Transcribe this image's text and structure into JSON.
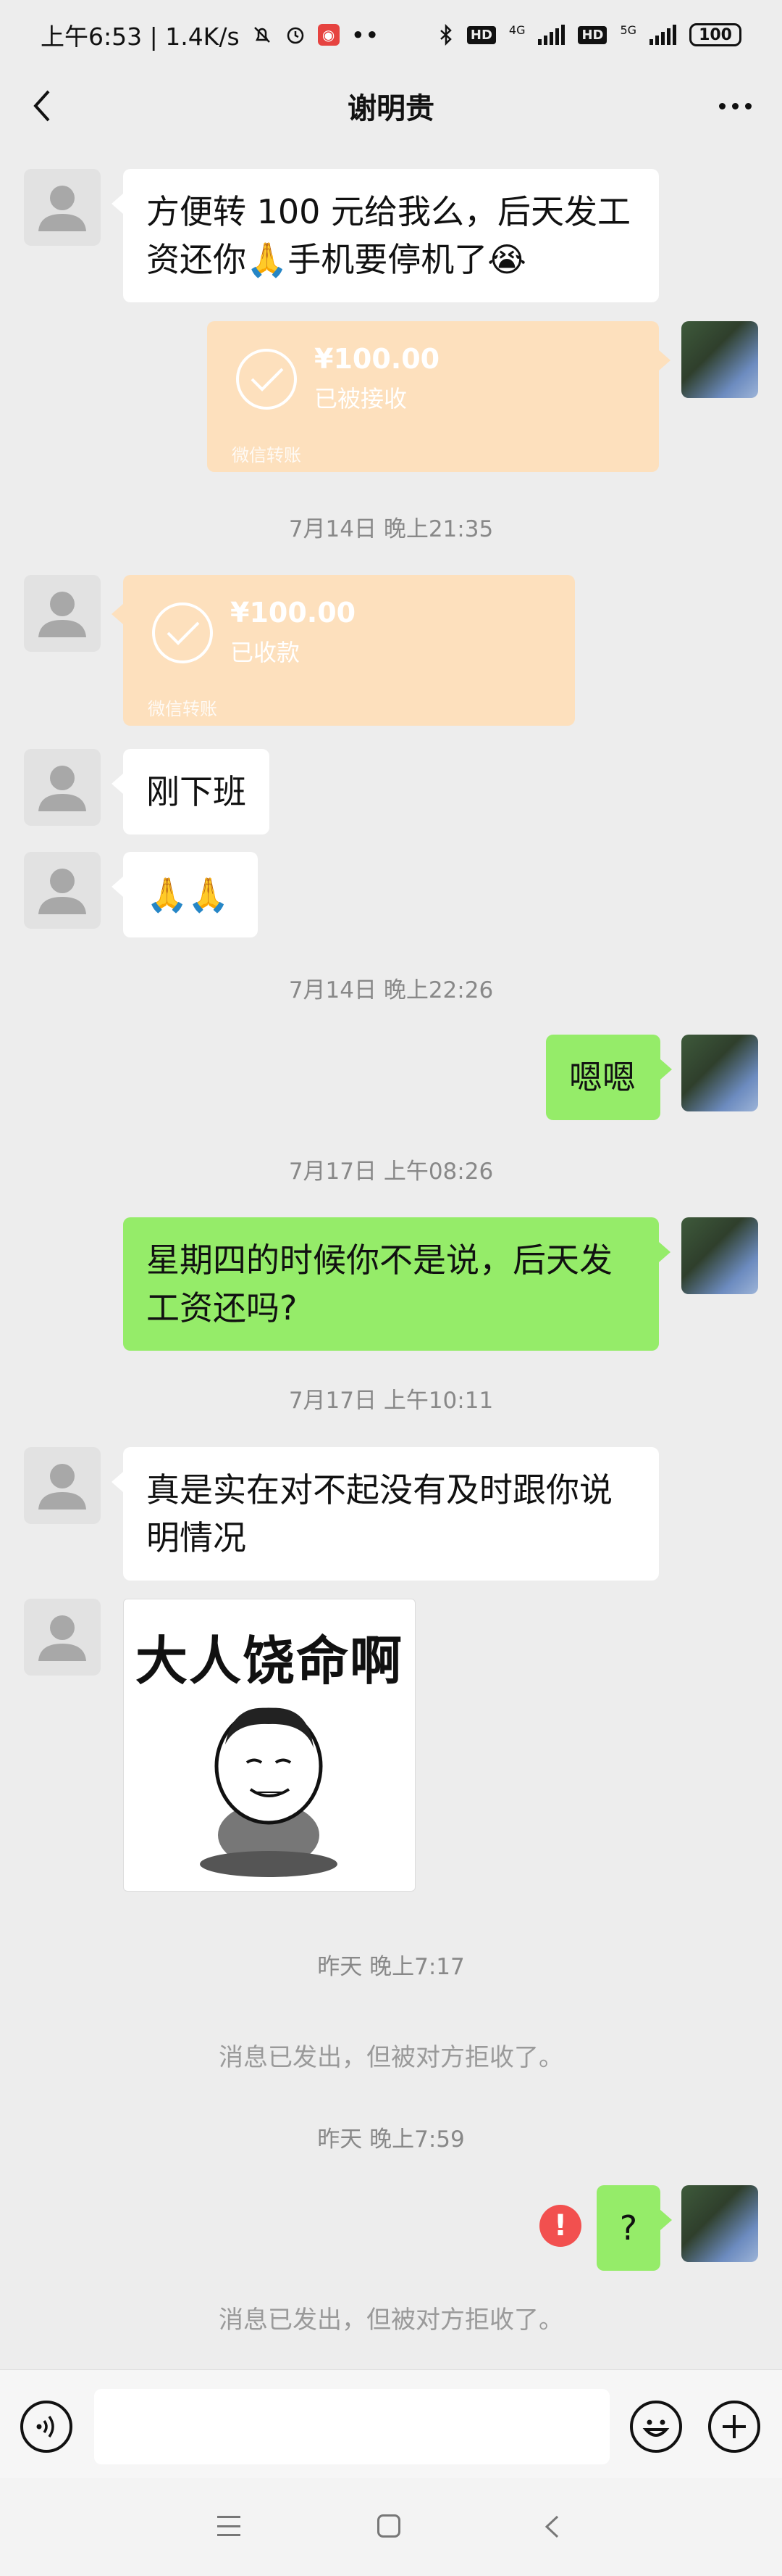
{
  "status_bar": {
    "time_speed": "上午6:53 | 1.4K/s",
    "dots": "••",
    "hd1": "HD",
    "net1": "4G",
    "hd2": "HD",
    "net2": "5G",
    "battery": "100"
  },
  "header": {
    "title": "谢明贵",
    "back_icon": "chevron-left-icon",
    "more_icon": "more-icon"
  },
  "messages": {
    "m1": "方便转 100 元给我么，后天发工资还你🙏手机要停机了😭",
    "transfer1": {
      "amount": "¥100.00",
      "status": "已被接收",
      "footer": "微信转账"
    },
    "ts1": "7月14日 晚上21:35",
    "transfer2": {
      "amount": "¥100.00",
      "status": "已收款",
      "footer": "微信转账"
    },
    "m2": "刚下班",
    "m3": "🙏🙏",
    "ts2": "7月14日 晚上22:26",
    "m4": "嗯嗯",
    "ts3": "7月17日 上午08:26",
    "m5": "星期四的时候你不是说，后天发工资还吗?",
    "ts4": "7月17日 上午10:11",
    "m6": "真是实在对不起没有及时跟你说明情况",
    "sticker_text": "大人饶命啊",
    "ts5": "昨天 晚上7:17",
    "sys1": "消息已发出，但被对方拒收了。",
    "ts6": "昨天 晚上7:59",
    "m7": "?",
    "error_mark": "!",
    "sys2": "消息已发出，但被对方拒收了。"
  },
  "colors": {
    "background": "#ededed",
    "self_bubble": "#95ec69",
    "transfer": "#fde0bd",
    "error": "#f2504f"
  }
}
